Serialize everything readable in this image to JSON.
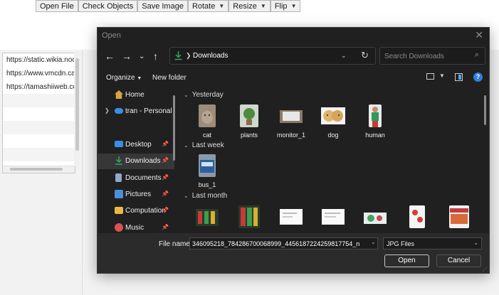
{
  "toolbar": {
    "open_file": "Open File",
    "check_objects": "Check Objects",
    "save_image": "Save Image",
    "rotate": "Rotate",
    "resize": "Resize",
    "flip": "Flip"
  },
  "url_list": [
    "https://static.wikia.nocoo",
    "https://www.vmcdn.ca/f/",
    "https://tamashiiweb.com"
  ],
  "dialog": {
    "title": "Open",
    "address": {
      "current": "Downloads"
    },
    "search": {
      "placeholder": "Search Downloads"
    },
    "commands": {
      "organize": "Organize",
      "new_folder": "New folder"
    },
    "sidebar": [
      {
        "label": "Home",
        "icon": "home-icon",
        "color": "#d9a441"
      },
      {
        "label": "tran - Personal",
        "icon": "cloud-icon",
        "color": "#3a8ee6"
      },
      {
        "label": "Desktop",
        "icon": "desktop-icon",
        "color": "#3a8ee6",
        "pinned": true
      },
      {
        "label": "Downloads",
        "icon": "download-icon",
        "color": "#2fa866",
        "pinned": true,
        "selected": true
      },
      {
        "label": "Documents",
        "icon": "document-icon",
        "color": "#8fa9c8",
        "pinned": true
      },
      {
        "label": "Pictures",
        "icon": "pictures-icon",
        "color": "#4a90d9",
        "pinned": true
      },
      {
        "label": "Computation",
        "icon": "folder-icon",
        "color": "#e8b84a",
        "pinned": true
      },
      {
        "label": "Music",
        "icon": "music-icon",
        "color": "#d9534f",
        "pinned": true
      }
    ],
    "groups": [
      {
        "label": "Yesterday",
        "files": [
          "cat",
          "plants",
          "monitor_1",
          "dog",
          "human"
        ]
      },
      {
        "label": "Last week",
        "files": [
          "bus_1"
        ]
      },
      {
        "label": "Last month",
        "files": [
          "",
          "",
          "",
          "",
          "",
          "",
          ""
        ]
      }
    ],
    "file_name_label": "File name:",
    "file_name_value": "346095218_784286700068999_4456187224259817754_n",
    "file_type": "JPG Files",
    "open_button": "Open",
    "cancel_button": "Cancel"
  }
}
